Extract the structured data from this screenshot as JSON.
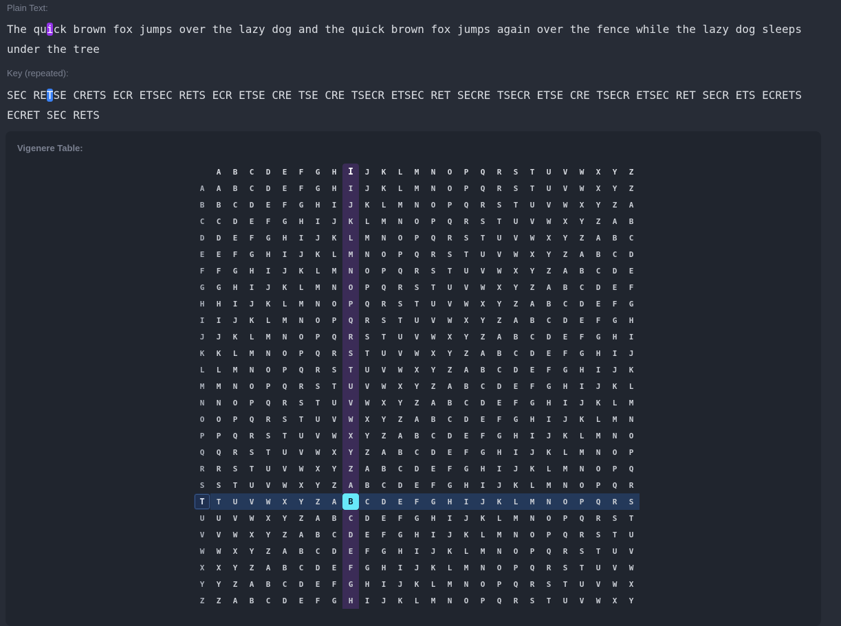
{
  "plain_text": {
    "label": "Plain Text:",
    "before": "The qu",
    "highlight": "i",
    "after": "ck brown fox jumps over the lazy dog and the quick brown fox jumps again over the fence while the lazy dog sleeps under the tree",
    "highlight_color": "#9333ea"
  },
  "key": {
    "label": "Key (repeated):",
    "before": "SEC RE",
    "highlight": "T",
    "after": "SE CRETS ECR ETSEC RETS ECR ETSE CRE TSE CRE TSECR ETSEC RET SECRE TSECR ETSE CRE TSECR ETSEC RET SECR ETS ECRETS ECRET SEC RETS",
    "highlight_color": "#3b82f6"
  },
  "vigenere": {
    "title": "Vigenere Table:",
    "alphabet": "ABCDEFGHIJKLMNOPQRSTUVWXYZ",
    "highlight_column": "I",
    "highlight_row": "T",
    "result_letter": "B",
    "column_color": "#3b2c57",
    "row_color": "#24395a",
    "result_color": "#67e8f9"
  }
}
